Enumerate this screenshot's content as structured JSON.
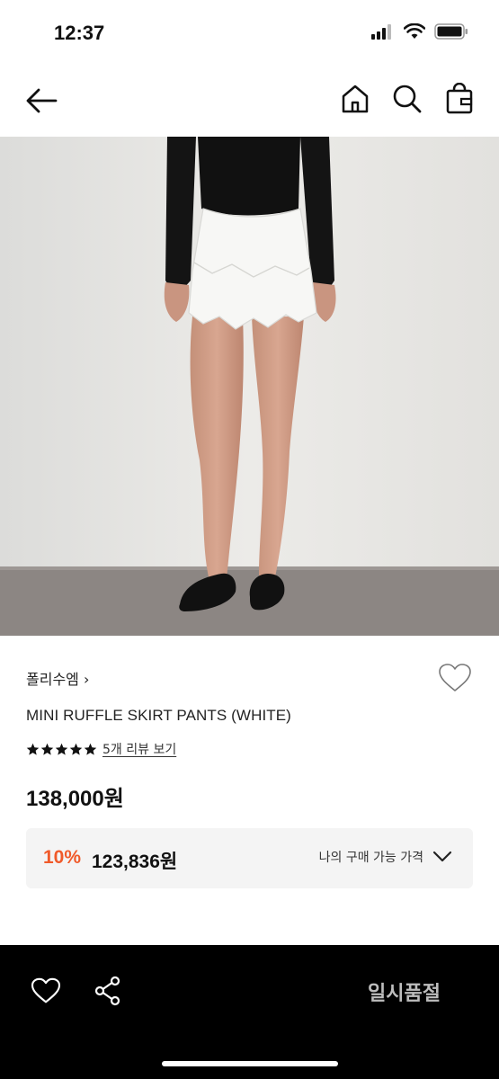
{
  "status_bar": {
    "time": "12:37"
  },
  "nav": {
    "back_icon": "arrow-left-icon",
    "home_icon": "home-icon",
    "search_icon": "search-icon",
    "bag_icon": "shopping-bag-icon"
  },
  "product": {
    "brand": "폴리수엠 ›",
    "name": "MINI RUFFLE SKIRT PANTS (WHITE)",
    "rating_stars": 5,
    "review_link": "5개 리뷰 보기",
    "price": "138,000원",
    "discount_rate": "10%",
    "discount_price": "123,836원",
    "my_price_label": "나의 구매 가능 가격"
  },
  "bottom_bar": {
    "soldout_label": "일시품절"
  },
  "colors": {
    "accent": "#f05a2a",
    "bottom_bar": "#000000",
    "discount_box": "#f4f4f4"
  }
}
